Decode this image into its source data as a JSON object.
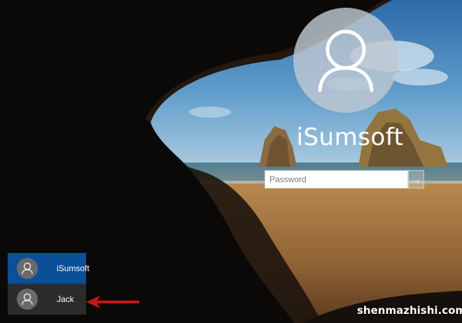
{
  "account": {
    "name": "iSumsoft",
    "avatar_icon": "user-icon"
  },
  "password_field": {
    "placeholder": "Password",
    "submit_icon": "arrow-right-icon",
    "submit_glyph": "→"
  },
  "user_list": [
    {
      "name": "iSumsoft",
      "selected": true,
      "icon": "user-icon"
    },
    {
      "name": "Jack",
      "selected": false,
      "icon": "user-icon"
    }
  ],
  "annotation": {
    "color": "#c0171b",
    "icon": "left-arrow-annotation"
  },
  "watermark": "shenmazhishi.com",
  "colors": {
    "selected_user": "#0a4f97",
    "unselected_user": "#2b2b2b",
    "avatar_bg": "#bec8d2"
  }
}
